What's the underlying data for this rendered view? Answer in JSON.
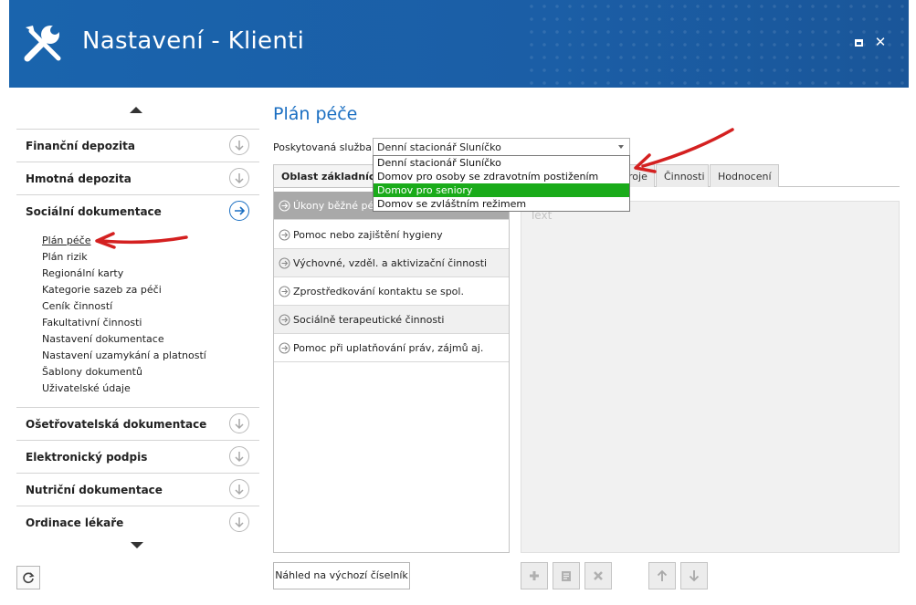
{
  "window": {
    "title": "Nastavení - Klienti"
  },
  "sidebar": {
    "sections": [
      {
        "label": "Finanční depozita",
        "expanded": false
      },
      {
        "label": "Hmotná depozita",
        "expanded": false
      },
      {
        "label": "Sociální dokumentace",
        "expanded": true
      },
      {
        "label": "Ošetřovatelská dokumentace",
        "expanded": false
      },
      {
        "label": "Elektronický podpis",
        "expanded": false
      },
      {
        "label": "Nutriční dokumentace",
        "expanded": false
      },
      {
        "label": "Ordinace lékaře",
        "expanded": false
      }
    ],
    "sub_items": [
      "Plán péče",
      "Plán rizik",
      "Regionální karty",
      "Kategorie sazeb za péči",
      "Ceník činností",
      "Fakultativní činnosti",
      "Nastavení dokumentace",
      "Nastavení uzamykání a platností",
      "Šablony dokumentů",
      "Uživatelské údaje"
    ],
    "selected_sub_item": "Plán péče"
  },
  "main": {
    "title": "Plán péče",
    "service_label": "Poskytovaná služba:",
    "service_value": "Denní stacionář Sluníčko",
    "dropdown_options": [
      "Denní stacionář Sluníčko",
      "Domov pro osoby se zdravotním postižením",
      "Domov pro seniory",
      "Domov se zvláštním režimem"
    ],
    "dropdown_highlighted": "Domov pro seniory",
    "tabs": {
      "main": "Oblast základních",
      "partial": "roje",
      "activities": "Činnosti",
      "evaluation": "Hodnocení"
    },
    "areas": [
      "Úkony běžné péče",
      "Pomoc nebo zajištění hygieny",
      "Výchovné, vzděl. a aktivizační činnosti",
      "Zprostředkování kontaktu se spol.",
      "Sociálně terapeutické činnosti",
      "Pomoc při uplatňování práv, zájmů aj."
    ],
    "text_placeholder": "Text",
    "preview_button": "Náhled na výchozí číselník"
  },
  "colors": {
    "header_bg": "#1a64ad",
    "accent": "#1b6fc2",
    "highlight": "#1aab1a",
    "selected_row": "#a9a9a9",
    "arrow": "#d42020"
  },
  "icons": {
    "header": "wrench-screwdriver-icon",
    "collapsed_section": "circle-down-arrow-icon",
    "expanded_section": "circle-right-arrow-icon",
    "row_marker": "circle-right-arrow-icon",
    "toolbar": [
      "plus-icon",
      "edit-icon",
      "delete-icon",
      "arrow-up-icon",
      "arrow-down-icon"
    ],
    "refresh": "refresh-icon"
  }
}
